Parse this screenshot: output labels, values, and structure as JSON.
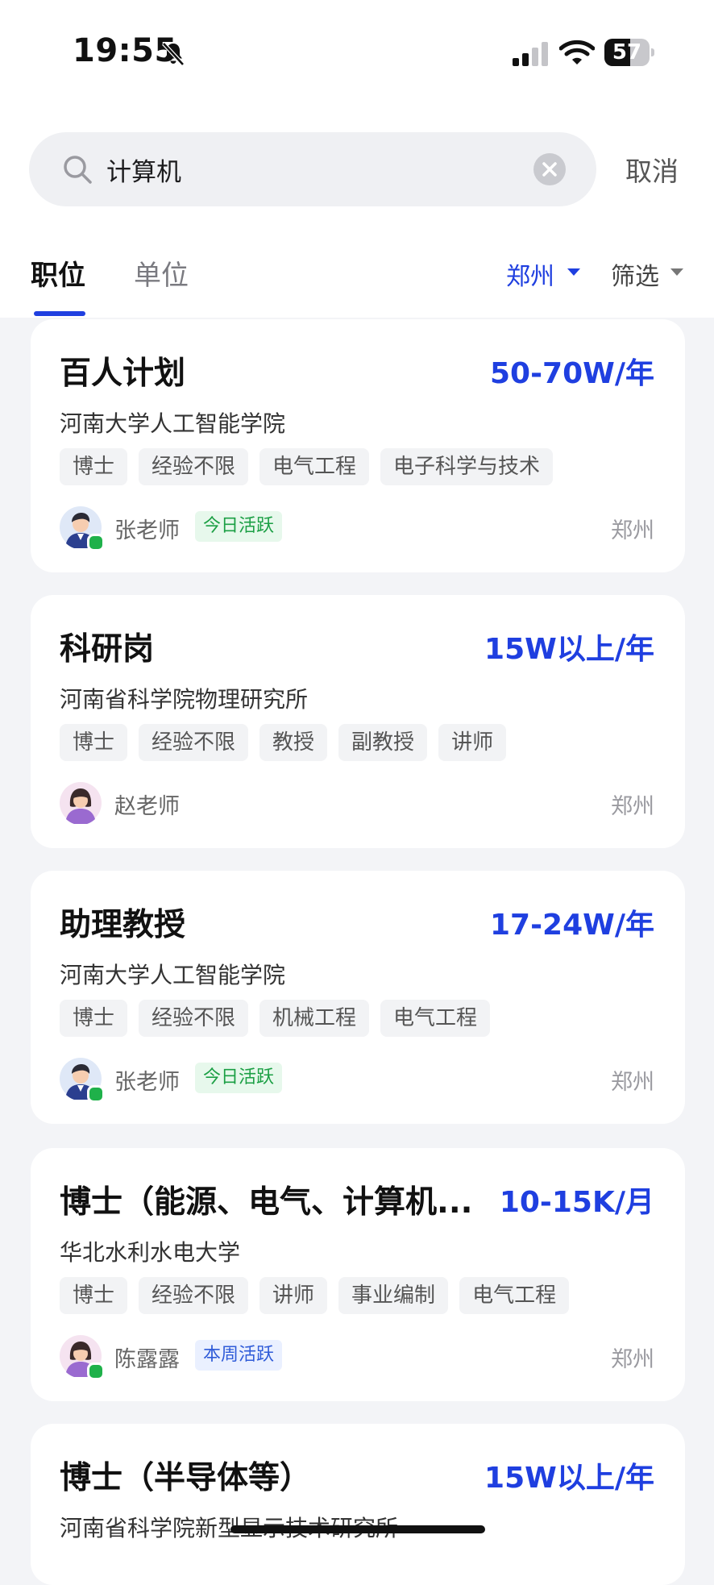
{
  "status_bar": {
    "time": "19:55",
    "battery": "57",
    "battery_level": 0.57
  },
  "search": {
    "query": "计算机",
    "placeholder": "",
    "cancel_label": "取消"
  },
  "tabs": [
    {
      "label": "职位",
      "active": true
    },
    {
      "label": "单位",
      "active": false
    }
  ],
  "filters": {
    "city": "郑州",
    "filter_label": "筛选"
  },
  "jobs": [
    {
      "title": "百人计划",
      "salary": "50-70W/年",
      "org": "河南大学人工智能学院",
      "tags": [
        "博士",
        "经验不限",
        "电气工程",
        "电子科学与技术"
      ],
      "contact": "张老师",
      "activity": "今日活跃",
      "city": "郑州"
    },
    {
      "title": "科研岗",
      "salary": "15W以上/年",
      "org": "河南省科学院物理研究所",
      "tags": [
        "博士",
        "经验不限",
        "教授",
        "副教授",
        "讲师"
      ],
      "contact": "赵老师",
      "activity": "",
      "city": "郑州"
    },
    {
      "title": "助理教授",
      "salary": "17-24W/年",
      "org": "河南大学人工智能学院",
      "tags": [
        "博士",
        "经验不限",
        "机械工程",
        "电气工程"
      ],
      "contact": "张老师",
      "activity": "今日活跃",
      "city": "郑州"
    },
    {
      "title": "博士（能源、电气、计算机...",
      "salary": "10-15K/月",
      "org": "华北水利水电大学",
      "tags": [
        "博士",
        "经验不限",
        "讲师",
        "事业编制",
        "电气工程"
      ],
      "contact": "陈露露",
      "activity": "本周活跃",
      "city": "郑州"
    },
    {
      "title": "博士（半导体等）",
      "salary": "15W以上/年",
      "org": "河南省科学院新型显示技术研究所",
      "tags": [],
      "contact": "",
      "activity": "",
      "city": ""
    }
  ],
  "colors": {
    "accent": "#1f3fe0",
    "active_green": "#1b9f44",
    "active_blue": "#2f5bd8",
    "page_bg": "#f3f4f7"
  }
}
